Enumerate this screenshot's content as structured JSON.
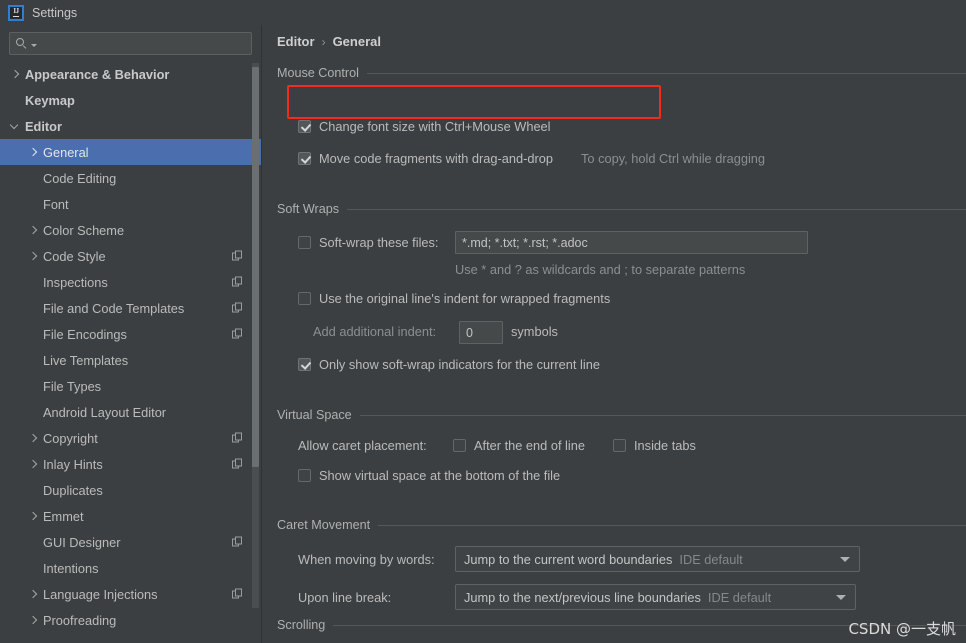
{
  "window": {
    "title": "Settings",
    "app_icon": "intellij-idea-icon",
    "icon_text": "IJ"
  },
  "colors": {
    "background": "#3c3f41",
    "selection": "#4b6eaf",
    "highlight_box": "#f52a1f",
    "text": "#bbbbbb",
    "dim_text": "#8c8f91",
    "separator": "#555859"
  },
  "search": {
    "value": "",
    "placeholder": "",
    "icon": "search-icon"
  },
  "sidebar": {
    "items": [
      {
        "label": "Appearance & Behavior",
        "indent": 0,
        "arrow": "right",
        "bold": true,
        "selected": false,
        "copy": false
      },
      {
        "label": "Keymap",
        "indent": 0,
        "arrow": "none",
        "bold": true,
        "selected": false,
        "copy": false
      },
      {
        "label": "Editor",
        "indent": 0,
        "arrow": "down",
        "bold": true,
        "selected": false,
        "copy": false
      },
      {
        "label": "General",
        "indent": 1,
        "arrow": "right",
        "bold": false,
        "selected": true,
        "copy": false
      },
      {
        "label": "Code Editing",
        "indent": 1,
        "arrow": "none",
        "bold": false,
        "selected": false,
        "copy": false
      },
      {
        "label": "Font",
        "indent": 1,
        "arrow": "none",
        "bold": false,
        "selected": false,
        "copy": false
      },
      {
        "label": "Color Scheme",
        "indent": 1,
        "arrow": "right",
        "bold": false,
        "selected": false,
        "copy": false
      },
      {
        "label": "Code Style",
        "indent": 1,
        "arrow": "right",
        "bold": false,
        "selected": false,
        "copy": true
      },
      {
        "label": "Inspections",
        "indent": 1,
        "arrow": "none",
        "bold": false,
        "selected": false,
        "copy": true
      },
      {
        "label": "File and Code Templates",
        "indent": 1,
        "arrow": "none",
        "bold": false,
        "selected": false,
        "copy": true
      },
      {
        "label": "File Encodings",
        "indent": 1,
        "arrow": "none",
        "bold": false,
        "selected": false,
        "copy": true
      },
      {
        "label": "Live Templates",
        "indent": 1,
        "arrow": "none",
        "bold": false,
        "selected": false,
        "copy": false
      },
      {
        "label": "File Types",
        "indent": 1,
        "arrow": "none",
        "bold": false,
        "selected": false,
        "copy": false
      },
      {
        "label": "Android Layout Editor",
        "indent": 1,
        "arrow": "none",
        "bold": false,
        "selected": false,
        "copy": false
      },
      {
        "label": "Copyright",
        "indent": 1,
        "arrow": "right",
        "bold": false,
        "selected": false,
        "copy": true
      },
      {
        "label": "Inlay Hints",
        "indent": 1,
        "arrow": "right",
        "bold": false,
        "selected": false,
        "copy": true
      },
      {
        "label": "Duplicates",
        "indent": 1,
        "arrow": "none",
        "bold": false,
        "selected": false,
        "copy": false
      },
      {
        "label": "Emmet",
        "indent": 1,
        "arrow": "right",
        "bold": false,
        "selected": false,
        "copy": false
      },
      {
        "label": "GUI Designer",
        "indent": 1,
        "arrow": "none",
        "bold": false,
        "selected": false,
        "copy": true
      },
      {
        "label": "Intentions",
        "indent": 1,
        "arrow": "none",
        "bold": false,
        "selected": false,
        "copy": false
      },
      {
        "label": "Language Injections",
        "indent": 1,
        "arrow": "right",
        "bold": false,
        "selected": false,
        "copy": true
      },
      {
        "label": "Proofreading",
        "indent": 1,
        "arrow": "right",
        "bold": false,
        "selected": false,
        "copy": false
      }
    ]
  },
  "breadcrumb": {
    "parent": "Editor",
    "separator": "›",
    "current": "General"
  },
  "sections": {
    "mouse_control": {
      "title": "Mouse Control",
      "change_font_size": {
        "label": "Change font size with Ctrl+Mouse Wheel",
        "checked": true,
        "highlighted": true
      },
      "move_code_fragments": {
        "label": "Move code fragments with drag-and-drop",
        "checked": true,
        "hint": "To copy, hold Ctrl while dragging"
      }
    },
    "soft_wraps": {
      "title": "Soft Wraps",
      "soft_wrap_files": {
        "label": "Soft-wrap these files:",
        "checked": false,
        "value": "*.md; *.txt; *.rst; *.adoc"
      },
      "wildcard_hint": "Use * and ? as wildcards and ; to separate patterns",
      "original_indent": {
        "label": "Use the original line's indent for wrapped fragments",
        "checked": false
      },
      "additional_indent": {
        "label": "Add additional indent:",
        "value": "0",
        "suffix": "symbols"
      },
      "only_show_indicators": {
        "label": "Only show soft-wrap indicators for the current line",
        "checked": true
      }
    },
    "virtual_space": {
      "title": "Virtual Space",
      "allow_caret_label": "Allow caret placement:",
      "after_end_of_line": {
        "label": "After the end of line",
        "checked": false
      },
      "inside_tabs": {
        "label": "Inside tabs",
        "checked": false
      },
      "show_virtual_space": {
        "label": "Show virtual space at the bottom of the file",
        "checked": false
      }
    },
    "caret_movement": {
      "title": "Caret Movement",
      "when_moving_by_words": {
        "label": "When moving by words:",
        "value": "Jump to the current word boundaries",
        "hint": "IDE default"
      },
      "upon_line_break": {
        "label": "Upon line break:",
        "value": "Jump to the next/previous line boundaries",
        "hint": "IDE default"
      }
    },
    "scrolling": {
      "title": "Scrolling"
    }
  },
  "watermark": {
    "text": "CSDN @一支帆"
  }
}
